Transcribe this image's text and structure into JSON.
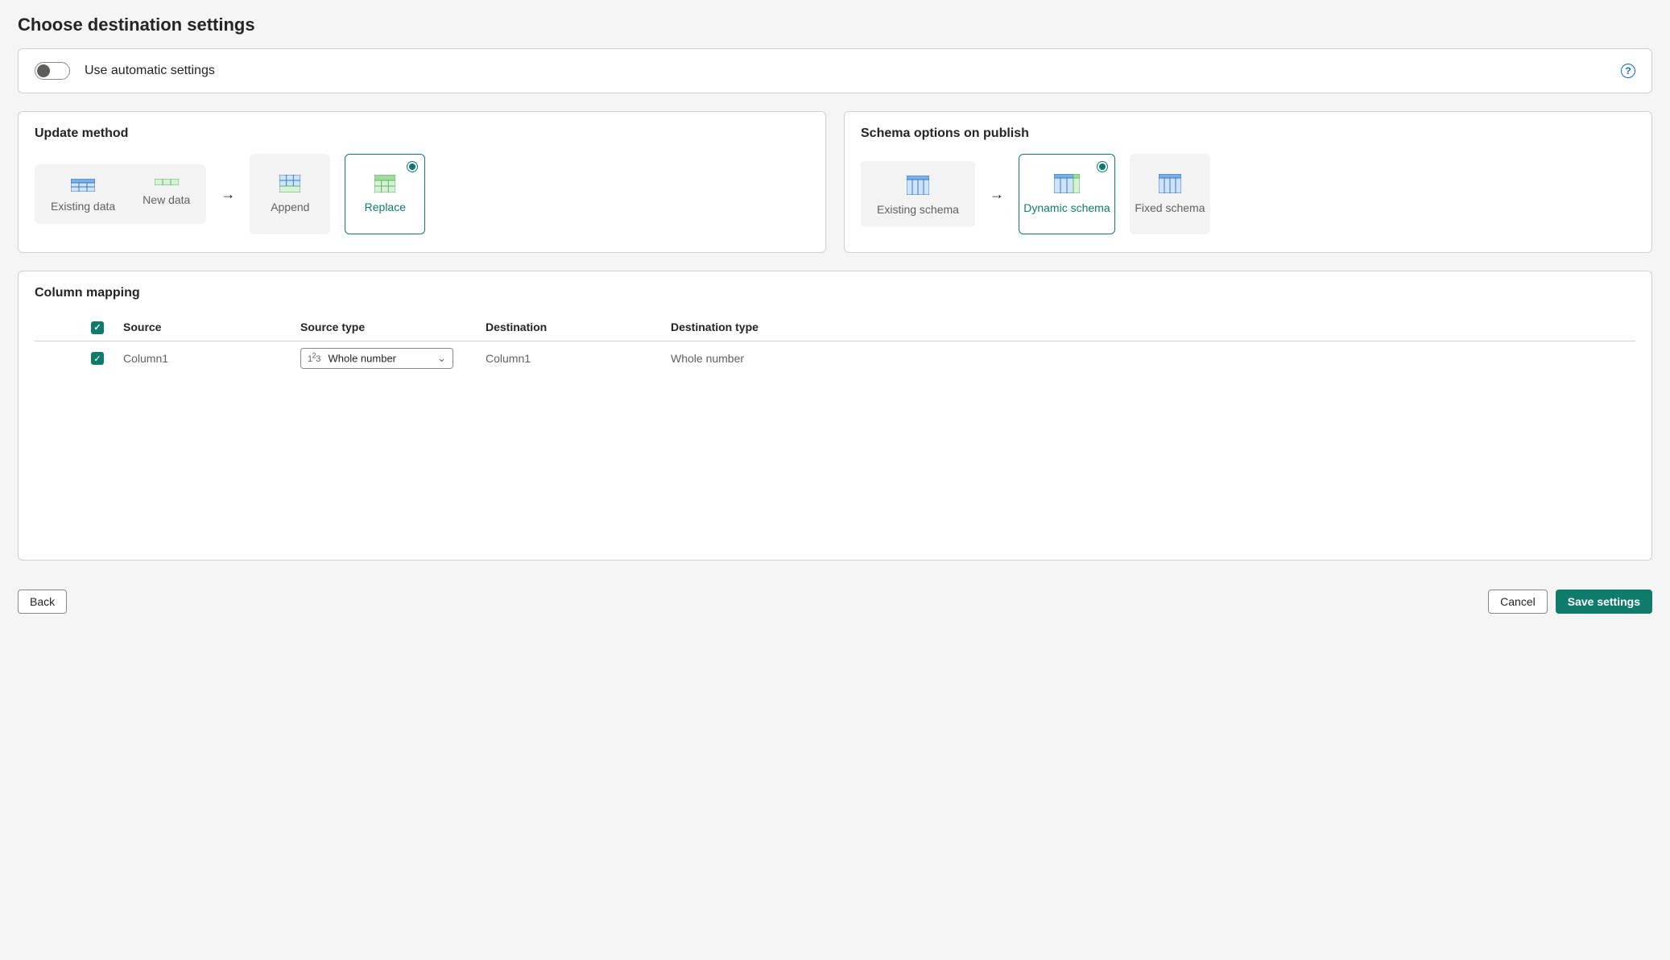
{
  "page": {
    "title": "Choose destination settings"
  },
  "autoSettings": {
    "label": "Use automatic settings",
    "enabled": false
  },
  "updateMethod": {
    "title": "Update method",
    "existing": "Existing data",
    "newData": "New data",
    "append": "Append",
    "replace": "Replace",
    "selected": "replace"
  },
  "schemaOptions": {
    "title": "Schema options on publish",
    "existing": "Existing schema",
    "dynamic": "Dynamic schema",
    "fixed": "Fixed schema",
    "selected": "dynamic"
  },
  "columnMapping": {
    "title": "Column mapping",
    "headers": {
      "source": "Source",
      "sourceType": "Source type",
      "destination": "Destination",
      "destinationType": "Destination type"
    },
    "rows": [
      {
        "checked": true,
        "source": "Column1",
        "sourceType": "Whole number",
        "destination": "Column1",
        "destinationType": "Whole number"
      }
    ]
  },
  "footer": {
    "back": "Back",
    "cancel": "Cancel",
    "save": "Save settings"
  }
}
